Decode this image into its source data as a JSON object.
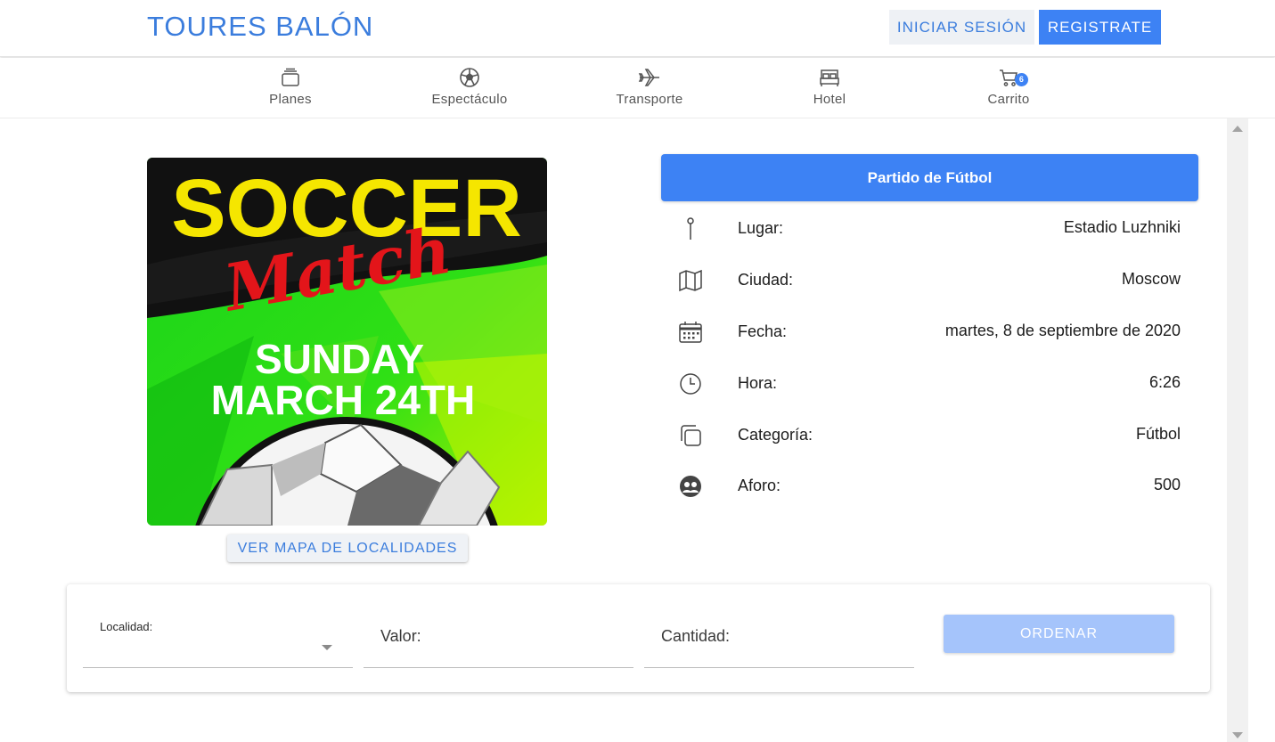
{
  "header": {
    "brand": "TOURES BALÓN",
    "login_label": "INICIAR SESIÓN",
    "register_label": "REGISTRATE"
  },
  "nav": {
    "items": [
      {
        "label": "Planes",
        "icon": "layers-icon"
      },
      {
        "label": "Espectáculo",
        "icon": "soccer-ball-icon"
      },
      {
        "label": "Transporte",
        "icon": "airplane-icon"
      },
      {
        "label": "Hotel",
        "icon": "bed-icon"
      },
      {
        "label": "Carrito",
        "icon": "cart-icon",
        "badge": "6"
      }
    ]
  },
  "poster": {
    "line1": "SOCCER",
    "line2": "Match",
    "line3": "SUNDAY",
    "line4": "MARCH 24TH"
  },
  "map_button_label": "VER MAPA DE LOCALIDADES",
  "event": {
    "title": "Partido de Fútbol",
    "details": [
      {
        "icon": "pin-icon",
        "label": "Lugar:",
        "value": "Estadio Luzhniki"
      },
      {
        "icon": "map-icon",
        "label": "Ciudad:",
        "value": "Moscow"
      },
      {
        "icon": "calendar-icon",
        "label": "Fecha:",
        "value": "martes, 8 de septiembre de 2020"
      },
      {
        "icon": "clock-icon",
        "label": "Hora:",
        "value": "6:26"
      },
      {
        "icon": "category-icon",
        "label": "Categoría:",
        "value": "Fútbol"
      },
      {
        "icon": "people-icon",
        "label": "Aforo:",
        "value": "500"
      }
    ]
  },
  "order": {
    "locality_label": "Localidad:",
    "value_label": "Valor:",
    "quantity_label": "Cantidad:",
    "order_button_label": "ORDENAR"
  }
}
